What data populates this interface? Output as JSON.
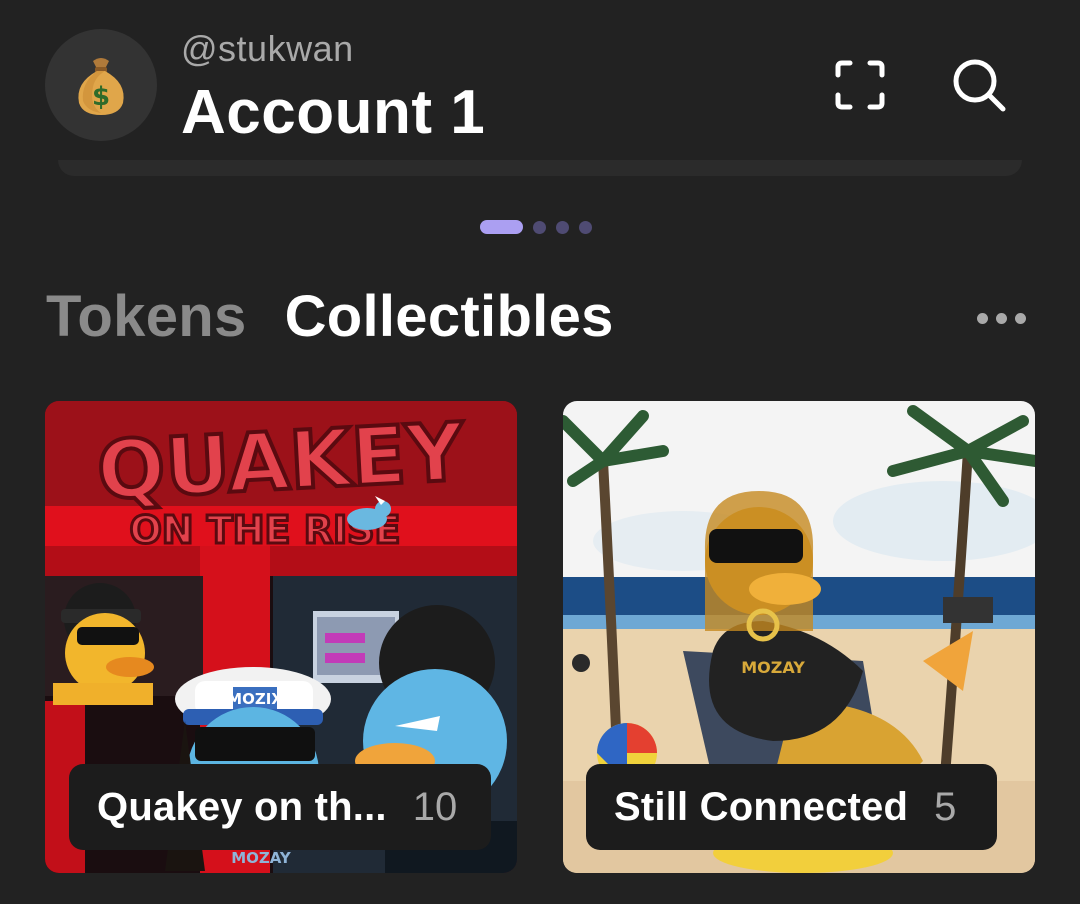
{
  "header": {
    "avatar_icon": "money-bag-icon",
    "avatar_glyph": "💰",
    "username": "@stukwan",
    "account_name": "Account 1",
    "scan_icon": "scan-frame-icon",
    "search_icon": "search-icon"
  },
  "pager": {
    "pages": 4,
    "active_index": 0,
    "active_color": "#ab9ff2",
    "inactive_color": "#4f4b73"
  },
  "tabs": [
    {
      "label": "Tokens",
      "active": false
    },
    {
      "label": "Collectibles",
      "active": true
    }
  ],
  "more_icon": "more-horizontal-icon",
  "collectibles": [
    {
      "name": "Quakey on th...",
      "count": "10",
      "art": "quakey-on-the-rise-art"
    },
    {
      "name": "Still Connected",
      "count": "5",
      "art": "still-connected-art"
    }
  ],
  "art_text": {
    "quakey_title_1": "QUAKEY",
    "quakey_title_2": "ON THE RISE",
    "quakey_hat": "MOZIX",
    "quakey_shirt": "MOZAY",
    "still_shirt": "MOZAY"
  },
  "colors": {
    "background": "#222222",
    "label_bg": "#1c1c1c",
    "muted_text": "#a9a9a9"
  }
}
